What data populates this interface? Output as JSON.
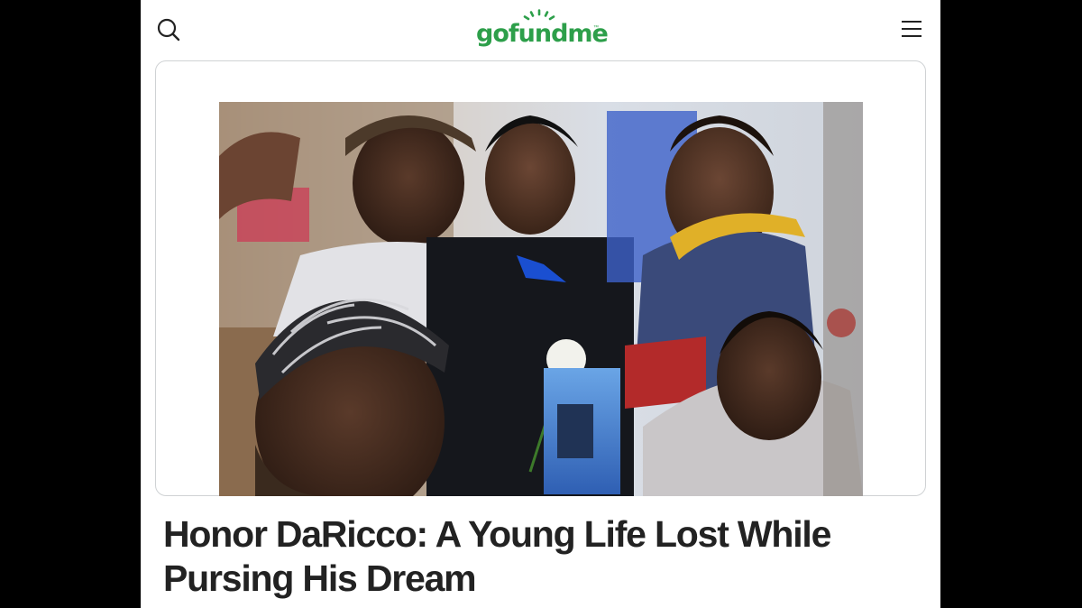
{
  "header": {
    "logo_text": "gofundme",
    "logo_tm": "™",
    "search_icon": "search-icon",
    "menu_icon": "hamburger-menu-icon"
  },
  "colors": {
    "brand_green": "#2d9f4a",
    "title_text": "#222222",
    "card_border": "#cfd2d4",
    "background": "#000000"
  },
  "campaign": {
    "title": "Honor DaRicco: A Young Life Lost While Pursing His Dream"
  }
}
